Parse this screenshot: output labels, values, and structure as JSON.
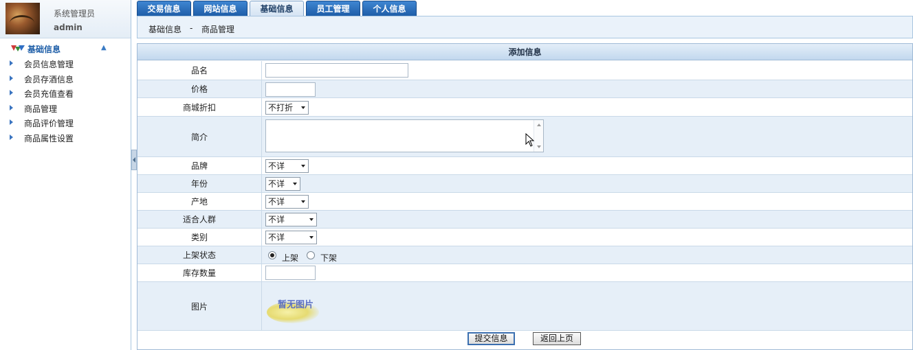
{
  "user": {
    "role": "系统管理员",
    "name": "admin"
  },
  "nav": {
    "title": "基础信息",
    "items": [
      {
        "label": "会员信息管理"
      },
      {
        "label": "会员存酒信息"
      },
      {
        "label": "会员充值查看"
      },
      {
        "label": "商品管理"
      },
      {
        "label": "商品评价管理"
      },
      {
        "label": "商品属性设置"
      }
    ]
  },
  "tabs": [
    {
      "label": "交易信息"
    },
    {
      "label": "网站信息"
    },
    {
      "label": "基础信息",
      "active": true
    },
    {
      "label": "员工管理"
    },
    {
      "label": "个人信息"
    }
  ],
  "breadcrumb": {
    "root": "基础信息",
    "sep": "-",
    "current": "商品管理"
  },
  "form": {
    "title": "添加信息",
    "fields": {
      "name": {
        "label": "品名",
        "value": ""
      },
      "price": {
        "label": "价格",
        "value": ""
      },
      "discount": {
        "label": "商城折扣",
        "value": "不打折"
      },
      "intro": {
        "label": "简介",
        "value": ""
      },
      "brand": {
        "label": "品牌",
        "value": "不详"
      },
      "year": {
        "label": "年份",
        "value": "不详"
      },
      "origin": {
        "label": "产地",
        "value": "不详"
      },
      "audience": {
        "label": "适合人群",
        "value": "不详"
      },
      "category": {
        "label": "类别",
        "value": "不详"
      },
      "status": {
        "label": "上架状态",
        "options": [
          "上架",
          "下架"
        ],
        "selected": "上架"
      },
      "stock": {
        "label": "库存数量",
        "value": ""
      },
      "image": {
        "label": "图片",
        "placeholder": "暂无图片"
      }
    },
    "buttons": {
      "submit": "提交信息",
      "back": "返回上页"
    }
  },
  "colors": {
    "tab_blue": "#2a6fc0",
    "nav_accent": "#1f5fa8",
    "row_alt": "#e6eff8"
  }
}
